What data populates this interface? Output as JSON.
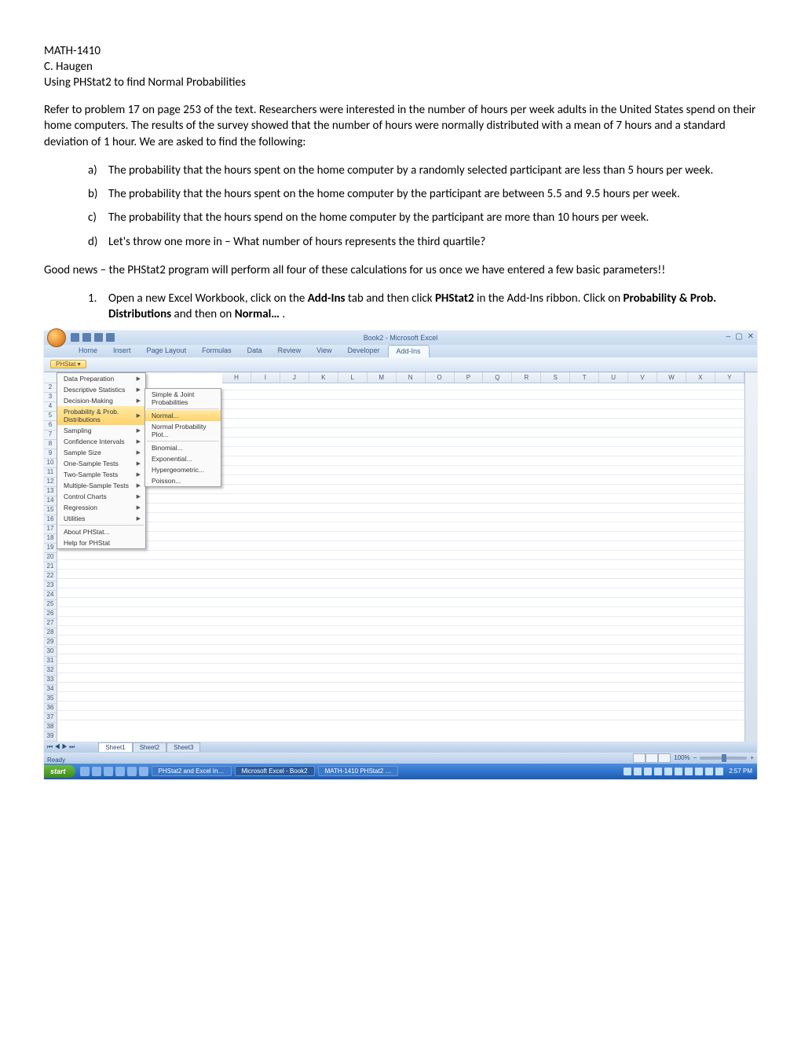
{
  "doc": {
    "course": "MATH-1410",
    "author": "C. Haugen",
    "title": "Using PHStat2 to find Normal Probabilities",
    "intro": "Refer to problem 17 on page 253 of the text.  Researchers were interested in the number of hours per week adults in the United States spend on their home computers.  The results of the survey showed that the number of hours were normally distributed with a mean of 7 hours and a standard deviation of 1 hour.  We are asked to find the following:",
    "items": {
      "a_marker": "a)",
      "a": "The probability that the hours spent on the home computer by a randomly selected participant are less than 5 hours per week.",
      "b_marker": "b)",
      "b": "The probability that the hours spent on the home computer by the participant are between 5.5 and 9.5 hours per week.",
      "c_marker": "c)",
      "c": "The probability that the hours spend on the home computer by the participant are more than 10 hours per week.",
      "d_marker": "d)",
      "d": "Let's throw one more in – What number of hours represents the third quartile?"
    },
    "good_news": "Good news – the PHStat2 program will perform all four of these calculations for us once we have entered a few basic parameters!!",
    "step1_marker": "1.",
    "step1_a": "Open a new Excel Workbook, click on the ",
    "step1_b": "Add-Ins",
    "step1_c": " tab and then click ",
    "step1_d": "PHStat2",
    "step1_e": " in the Add-Ins ribbon.  Click on ",
    "step1_f": "Probability & Prob. Distributions",
    "step1_g": " and then on ",
    "step1_h": "Normal…",
    "step1_i": " ."
  },
  "excel": {
    "title": "Book2 - Microsoft Excel",
    "ribbon_tabs": {
      "home": "Home",
      "insert": "Insert",
      "page_layout": "Page Layout",
      "formulas": "Formulas",
      "data": "Data",
      "review": "Review",
      "view": "View",
      "developer": "Developer",
      "addins": "Add-Ins"
    },
    "phstat_button": "PHStat ▾",
    "menu": {
      "data_prep": "Data Preparation",
      "desc_stats": "Descriptive Statistics",
      "decision": "Decision-Making",
      "prob_dist": "Probability & Prob. Distributions",
      "sampling": "Sampling",
      "conf_int": "Confidence Intervals",
      "sample_size": "Sample Size",
      "one_sample": "One-Sample Tests",
      "two_sample": "Two-Sample Tests",
      "multi_sample": "Multiple-Sample Tests",
      "control": "Control Charts",
      "regression": "Regression",
      "utilities": "Utilities",
      "about": "About PHStat...",
      "help": "Help for PHStat"
    },
    "submenu": {
      "simple": "Simple & Joint Probabilities",
      "normal": "Normal...",
      "normal_plot": "Normal Probability Plot...",
      "binomial": "Binomial...",
      "exponential": "Exponential...",
      "hypergeo": "Hypergeometric...",
      "poisson": "Poisson..."
    },
    "cols": [
      "H",
      "I",
      "J",
      "K",
      "L",
      "M",
      "N",
      "O",
      "P",
      "Q",
      "R",
      "S",
      "T",
      "U",
      "V",
      "W",
      "X",
      "Y"
    ],
    "rows_low": [
      "2",
      "3",
      "4",
      "5",
      "6",
      "7",
      "8",
      "9",
      "10",
      "11",
      "12"
    ],
    "rows_high": [
      "13",
      "14",
      "15",
      "16",
      "17",
      "18",
      "19",
      "20",
      "21",
      "22",
      "23",
      "24",
      "25",
      "26",
      "27",
      "28",
      "29",
      "30",
      "31",
      "32",
      "33",
      "34",
      "35",
      "36",
      "37",
      "38",
      "39"
    ],
    "sheet_tabs": {
      "nav": "⏮ ◀ ▶ ⏭",
      "s1": "Sheet1",
      "s2": "Sheet2",
      "s3": "Sheet3"
    },
    "status_ready": "Ready",
    "zoom": "100%"
  },
  "taskbar": {
    "start": "start",
    "tasks": {
      "t1": "PHStat2 and Excel In…",
      "t2": "Microsoft Excel - Book2",
      "t3": "MATH-1410 PHStat2 …"
    },
    "clock": "2:57 PM"
  }
}
